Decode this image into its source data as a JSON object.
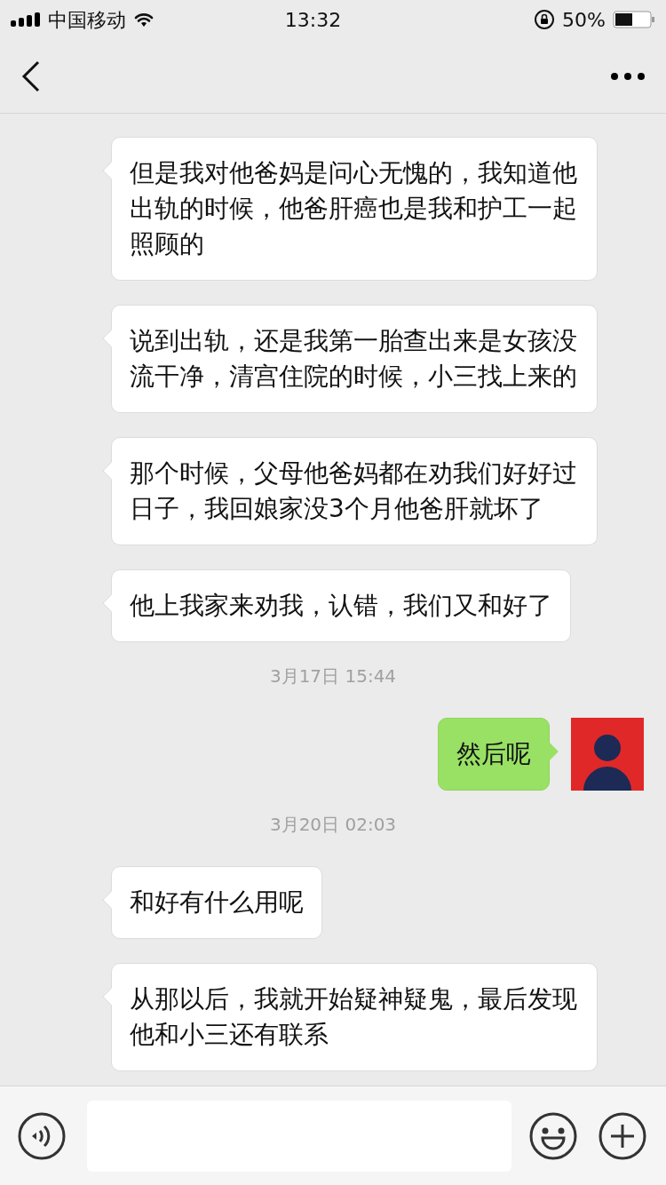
{
  "status_bar": {
    "carrier": "中国移动",
    "time": "13:32",
    "battery_text": "50%"
  },
  "messages": [
    {
      "kind": "message",
      "outgoing": false,
      "text": "但是我对他爸妈是问心无愧的，我知道他出轨的时候，他爸肝癌也是我和护工一起照顾的"
    },
    {
      "kind": "message",
      "outgoing": false,
      "text": "说到出轨，还是我第一胎查出来是女孩没流干净，清宫住院的时候，小三找上来的"
    },
    {
      "kind": "message",
      "outgoing": false,
      "text": "那个时候，父母他爸妈都在劝我们好好过日子，我回娘家没3个月他爸肝就坏了"
    },
    {
      "kind": "message",
      "outgoing": false,
      "text": "他上我家来劝我，认错，我们又和好了"
    },
    {
      "kind": "time",
      "text": "3月17日 15:44"
    },
    {
      "kind": "message",
      "outgoing": true,
      "text": "然后呢"
    },
    {
      "kind": "time",
      "text": "3月20日 02:03"
    },
    {
      "kind": "message",
      "outgoing": false,
      "text": "和好有什么用呢"
    },
    {
      "kind": "message",
      "outgoing": false,
      "text": "从那以后，我就开始疑神疑鬼，最后发现他和小三还有联系"
    }
  ]
}
